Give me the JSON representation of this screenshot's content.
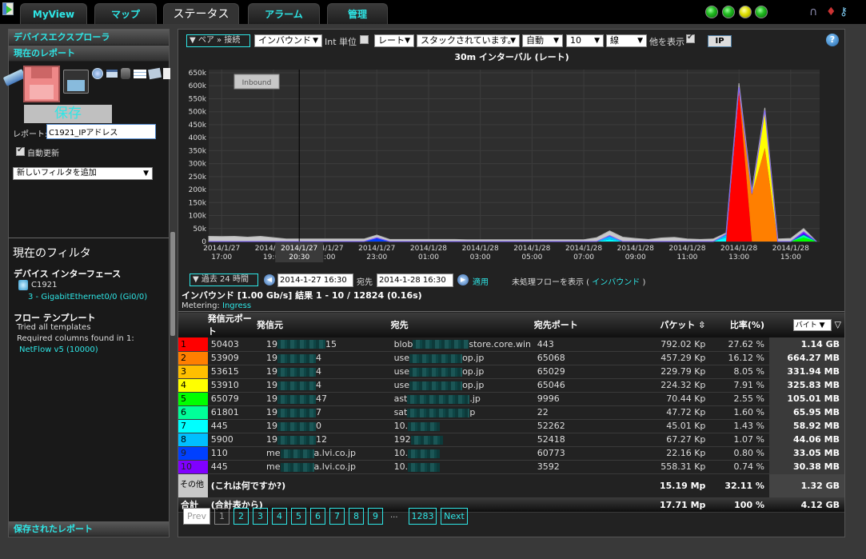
{
  "nav": {
    "tabs": [
      {
        "label": "MyView",
        "active": false
      },
      {
        "label": "マップ",
        "active": false
      },
      {
        "label": "ステータス",
        "active": true
      },
      {
        "label": "アラーム",
        "active": false
      },
      {
        "label": "管理",
        "active": false
      }
    ],
    "status_lights": [
      "green",
      "green",
      "yellow",
      "green"
    ],
    "top_icons": [
      "headphones-icon",
      "tie-icon",
      "tools-icon"
    ]
  },
  "sidebar": {
    "device_explorer": "デバイスエクスプローラ",
    "current_report": "現在のレポート",
    "save_label": "保存",
    "report_label": "レポート:",
    "report_value": "C1921_IPアドレス",
    "auto_update_label": "自動更新",
    "auto_update_checked": true,
    "add_filter": "新しいフィルタを追加",
    "current_filter_title": "現在のフィルタ",
    "device_interface_title": "デバイス インターフェース",
    "device_name": "C1921",
    "interface": "3 - GigabitEthernet0/0 (Gi0/0)",
    "flow_template_title": "フロー テンプレート",
    "tried_templates": "Tried all templates",
    "required_columns": "Required columns found in 1:",
    "netflow_link": "NetFlow v5 (10000)",
    "saved_reports": "保存されたレポート",
    "toolbar_icons": [
      "eraser-icon",
      "save-icon",
      "save-as-icon",
      "schedule-icon",
      "print-icon",
      "database-export-icon",
      "table-icon",
      "email-icon",
      "pdf-icon"
    ]
  },
  "controls": {
    "pair_toggle": "▼ ペア » 接続",
    "direction": "インバウンド",
    "int_unit_label": "Int 単位",
    "int_unit_checked": false,
    "rate": "レート",
    "stack": "スタックされています。",
    "auto": "自動",
    "count": "10",
    "line": "線",
    "show_other_label": "他を表示",
    "show_other_checked": true,
    "ip_button": "IP",
    "help": "?"
  },
  "time": {
    "range_toggle": "▼ 過去 24 時間",
    "from": "2014-1-27 16:30",
    "to_label": "宛先",
    "to": "2014-1-28 16:30",
    "apply": "適用",
    "raw_flows_label": "未処理フローを表示 (",
    "raw_flows_link": "インバウンド",
    "raw_flows_close": ")"
  },
  "summary": {
    "result_line": "インバウンド [1.00 Gb/s] 結果 1 - 10 / 12824 (0.16s)",
    "metering_label": "Metering:",
    "metering_value": "Ingress"
  },
  "chart_data": {
    "type": "area",
    "title": "30m インターバル (レート)",
    "legend_label": "Inbound",
    "stacked": true,
    "ylim": [
      0,
      650000
    ],
    "yticks": [
      "0",
      "50k",
      "100k",
      "150k",
      "200k",
      "250k",
      "300k",
      "350k",
      "400k",
      "450k",
      "500k",
      "550k",
      "600k",
      "650k"
    ],
    "xticks": [
      {
        "date": "2014/1/27",
        "time": "17:00"
      },
      {
        "date": "2014/1/27",
        "time": "19:00"
      },
      {
        "date": "2014/1/27",
        "time": "21:00"
      },
      {
        "date": "2014/1/27",
        "time": "23:00"
      },
      {
        "date": "2014/1/28",
        "time": "01:00"
      },
      {
        "date": "2014/1/28",
        "time": "03:00"
      },
      {
        "date": "2014/1/28",
        "time": "05:00"
      },
      {
        "date": "2014/1/28",
        "time": "07:00"
      },
      {
        "date": "2014/1/28",
        "time": "09:00"
      },
      {
        "date": "2014/1/28",
        "time": "11:00"
      },
      {
        "date": "2014/1/28",
        "time": "13:00"
      },
      {
        "date": "2014/1/28",
        "time": "15:00"
      }
    ],
    "cursor": {
      "date": "2014/1/27",
      "time": "20:30"
    },
    "x_hours_from_start": [
      0,
      0.5,
      1,
      1.5,
      2,
      2.5,
      3,
      3.5,
      4,
      4.5,
      5,
      5.5,
      6,
      6.5,
      7,
      7.5,
      8,
      8.5,
      9,
      9.5,
      10,
      10.5,
      11,
      11.5,
      12,
      12.5,
      13,
      13.5,
      14,
      14.5,
      15,
      15.5,
      16,
      16.5,
      17,
      17.5,
      18,
      18.5,
      19,
      19.5,
      20,
      20.5,
      21,
      21.5,
      22,
      22.5,
      23,
      23.5
    ],
    "series": [
      {
        "name": "1",
        "color": "#ff0000",
        "values": [
          0,
          0,
          0,
          0,
          0,
          0,
          0,
          0,
          0,
          0,
          0,
          0,
          0,
          0,
          0,
          0,
          0,
          0,
          0,
          0,
          0,
          0,
          0,
          0,
          0,
          0,
          0,
          0,
          0,
          0,
          0,
          0,
          0,
          0,
          0,
          0,
          0,
          0,
          0,
          0,
          0,
          580000,
          0,
          0,
          0,
          0,
          0,
          0
        ]
      },
      {
        "name": "2",
        "color": "#ff7f00",
        "values": [
          0,
          0,
          0,
          0,
          0,
          0,
          0,
          0,
          0,
          0,
          0,
          0,
          0,
          0,
          0,
          0,
          0,
          0,
          0,
          0,
          0,
          0,
          0,
          0,
          0,
          0,
          0,
          0,
          0,
          0,
          0,
          0,
          0,
          0,
          0,
          0,
          0,
          0,
          0,
          0,
          0,
          0,
          180000,
          360000,
          0,
          0,
          0,
          0
        ]
      },
      {
        "name": "3",
        "color": "#ffbf00",
        "values": [
          0,
          0,
          0,
          0,
          0,
          0,
          0,
          0,
          0,
          0,
          0,
          0,
          0,
          0,
          0,
          0,
          0,
          0,
          0,
          0,
          0,
          0,
          0,
          0,
          0,
          0,
          0,
          0,
          0,
          0,
          0,
          0,
          0,
          0,
          0,
          0,
          0,
          0,
          0,
          0,
          0,
          10000,
          0,
          0,
          0,
          0,
          0,
          0
        ]
      },
      {
        "name": "4",
        "color": "#ffff00",
        "values": [
          0,
          0,
          0,
          0,
          0,
          0,
          0,
          0,
          0,
          0,
          0,
          0,
          0,
          0,
          0,
          0,
          0,
          0,
          0,
          0,
          0,
          0,
          0,
          0,
          0,
          0,
          0,
          0,
          0,
          0,
          0,
          0,
          0,
          0,
          0,
          0,
          0,
          0,
          0,
          0,
          0,
          0,
          0,
          140000,
          0,
          0,
          0,
          0
        ]
      },
      {
        "name": "5",
        "color": "#00ff00",
        "values": [
          0,
          0,
          0,
          0,
          0,
          0,
          0,
          0,
          0,
          0,
          0,
          0,
          0,
          0,
          0,
          0,
          0,
          0,
          0,
          0,
          0,
          0,
          0,
          0,
          0,
          0,
          0,
          0,
          0,
          0,
          0,
          0,
          0,
          0,
          0,
          0,
          0,
          0,
          0,
          0,
          0,
          0,
          0,
          0,
          0,
          0,
          15000,
          0
        ]
      },
      {
        "name": "6",
        "color": "#00ff99",
        "values": [
          0,
          0,
          0,
          0,
          0,
          0,
          0,
          0,
          0,
          0,
          0,
          0,
          0,
          0,
          0,
          0,
          0,
          0,
          0,
          0,
          0,
          0,
          0,
          0,
          0,
          0,
          0,
          0,
          0,
          0,
          0,
          0,
          0,
          0,
          0,
          0,
          0,
          0,
          0,
          0,
          0,
          0,
          0,
          0,
          0,
          0,
          10000,
          0
        ]
      },
      {
        "name": "7",
        "color": "#00ffff",
        "values": [
          0,
          0,
          0,
          0,
          0,
          0,
          0,
          0,
          0,
          0,
          0,
          0,
          0,
          0,
          0,
          0,
          0,
          0,
          0,
          0,
          0,
          0,
          0,
          0,
          0,
          0,
          0,
          0,
          0,
          0,
          0,
          8000,
          0,
          0,
          0,
          0,
          0,
          0,
          0,
          0,
          15000,
          0,
          0,
          0,
          0,
          0,
          0,
          0
        ]
      },
      {
        "name": "8",
        "color": "#00bfff",
        "values": [
          0,
          0,
          0,
          0,
          0,
          0,
          0,
          0,
          0,
          0,
          0,
          0,
          0,
          0,
          0,
          0,
          0,
          0,
          0,
          0,
          0,
          0,
          0,
          0,
          0,
          0,
          0,
          0,
          0,
          0,
          0,
          12000,
          0,
          0,
          0,
          0,
          0,
          0,
          0,
          0,
          10000,
          0,
          0,
          0,
          0,
          0,
          0,
          0
        ]
      },
      {
        "name": "9",
        "color": "#0040ff",
        "values": [
          0,
          0,
          0,
          0,
          0,
          0,
          0,
          0,
          0,
          0,
          0,
          0,
          0,
          12000,
          0,
          0,
          0,
          0,
          0,
          0,
          0,
          0,
          0,
          0,
          0,
          0,
          0,
          0,
          0,
          0,
          0,
          0,
          0,
          0,
          0,
          0,
          0,
          0,
          0,
          0,
          0,
          0,
          0,
          0,
          0,
          0,
          5000,
          0
        ]
      },
      {
        "name": "10",
        "color": "#8000ff",
        "values": [
          0,
          0,
          0,
          0,
          0,
          0,
          0,
          0,
          0,
          0,
          0,
          0,
          0,
          3000,
          0,
          0,
          0,
          0,
          0,
          0,
          0,
          0,
          0,
          0,
          0,
          0,
          0,
          0,
          0,
          0,
          0,
          3000,
          0,
          0,
          0,
          0,
          0,
          0,
          0,
          0,
          3000,
          5000,
          5000,
          5000,
          0,
          0,
          8000,
          0
        ]
      },
      {
        "name": "その他",
        "color": "#c8c8c8",
        "values": [
          20000,
          19000,
          20000,
          17000,
          20000,
          15000,
          10000,
          10000,
          10000,
          10000,
          10000,
          10000,
          10000,
          10000,
          8000,
          8000,
          8000,
          8000,
          8000,
          8000,
          7000,
          7000,
          7000,
          7000,
          7000,
          7000,
          7000,
          7000,
          7000,
          7000,
          15000,
          18000,
          17000,
          12000,
          8000,
          14000,
          16000,
          10000,
          8000,
          10000,
          5000,
          15000,
          10000,
          10000,
          10000,
          12000,
          12000,
          0
        ]
      }
    ]
  },
  "table": {
    "headers": {
      "src_port": "発信元ポート",
      "src": "発信元",
      "dst": "宛先",
      "dst_port": "宛先ポート",
      "packets": "パケット",
      "ratio": "比率(%)",
      "bytes_select": "バイト"
    },
    "rows": [
      {
        "rank": "1",
        "color": "#ff0000",
        "src_port": "50403",
        "src_pre": "19",
        "src_post": "15",
        "dst_pre": "blob",
        "dst_post": "store.core.win",
        "dst_port": "443",
        "packets": "792.02 Kp",
        "ratio": "27.62 %",
        "bytes": "1.14 GB"
      },
      {
        "rank": "2",
        "color": "#ff7f00",
        "src_port": "53909",
        "src_pre": "19",
        "src_post": "4",
        "dst_pre": "use",
        "dst_post": "op.jp",
        "dst_port": "65068",
        "packets": "457.29 Kp",
        "ratio": "16.12 %",
        "bytes": "664.27 MB"
      },
      {
        "rank": "3",
        "color": "#ffbf00",
        "src_port": "53615",
        "src_pre": "19",
        "src_post": "4",
        "dst_pre": "use",
        "dst_post": "op.jp",
        "dst_port": "65029",
        "packets": "229.79 Kp",
        "ratio": "8.05 %",
        "bytes": "331.94 MB"
      },
      {
        "rank": "4",
        "color": "#ffff00",
        "src_port": "53910",
        "src_pre": "19",
        "src_post": "4",
        "dst_pre": "use",
        "dst_post": "op.jp",
        "dst_port": "65046",
        "packets": "224.32 Kp",
        "ratio": "7.91 %",
        "bytes": "325.83 MB"
      },
      {
        "rank": "5",
        "color": "#00ff00",
        "src_port": "65079",
        "src_pre": "19",
        "src_post": "47",
        "dst_pre": "ast",
        "dst_post": ".jp",
        "dst_port": "9996",
        "packets": "70.44 Kp",
        "ratio": "2.55 %",
        "bytes": "105.01 MB"
      },
      {
        "rank": "6",
        "color": "#00ff99",
        "src_port": "61801",
        "src_pre": "19",
        "src_post": "7",
        "dst_pre": "sat",
        "dst_post": "p",
        "dst_port": "22",
        "packets": "47.72 Kp",
        "ratio": "1.60 %",
        "bytes": "65.95 MB"
      },
      {
        "rank": "7",
        "color": "#00ffff",
        "src_port": "445",
        "src_pre": "19",
        "src_post": "0",
        "dst_pre": "10.",
        "dst_post": "",
        "dst_port": "52262",
        "packets": "45.01 Kp",
        "ratio": "1.43 %",
        "bytes": "58.92 MB"
      },
      {
        "rank": "8",
        "color": "#00bfff",
        "src_port": "5900",
        "src_pre": "19",
        "src_post": "12",
        "dst_pre": "192",
        "dst_post": "",
        "dst_port": "52418",
        "packets": "67.27 Kp",
        "ratio": "1.07 %",
        "bytes": "44.06 MB"
      },
      {
        "rank": "9",
        "color": "#0040ff",
        "src_port": "110",
        "src_pre": "me",
        "src_post": "a.lvi.co.jp",
        "dst_pre": "10.",
        "dst_post": "",
        "dst_port": "60773",
        "packets": "22.16 Kp",
        "ratio": "0.80 %",
        "bytes": "33.05 MB"
      },
      {
        "rank": "10",
        "color": "#8000ff",
        "src_port": "445",
        "src_pre": "me",
        "src_post": "a.lvi.co.jp",
        "dst_pre": "10.",
        "dst_post": "",
        "dst_port": "3592",
        "packets": "558.31 Kp",
        "ratio": "0.74 %",
        "bytes": "30.38 MB"
      }
    ],
    "other": {
      "label": "その他",
      "desc": "(これは何ですか?)",
      "packets": "15.19 Mp",
      "ratio": "32.11 %",
      "bytes": "1.32 GB"
    },
    "total": {
      "label": "合計",
      "desc": "(合計表から)",
      "packets": "17.71 Mp",
      "ratio": "100 %",
      "bytes": "4.12 GB"
    }
  },
  "pagination": {
    "prev": "Prev",
    "pages": [
      "1",
      "2",
      "3",
      "4",
      "5",
      "6",
      "7",
      "8",
      "9"
    ],
    "ellipsis": "...",
    "last": "1283",
    "next": "Next",
    "current": "1"
  }
}
